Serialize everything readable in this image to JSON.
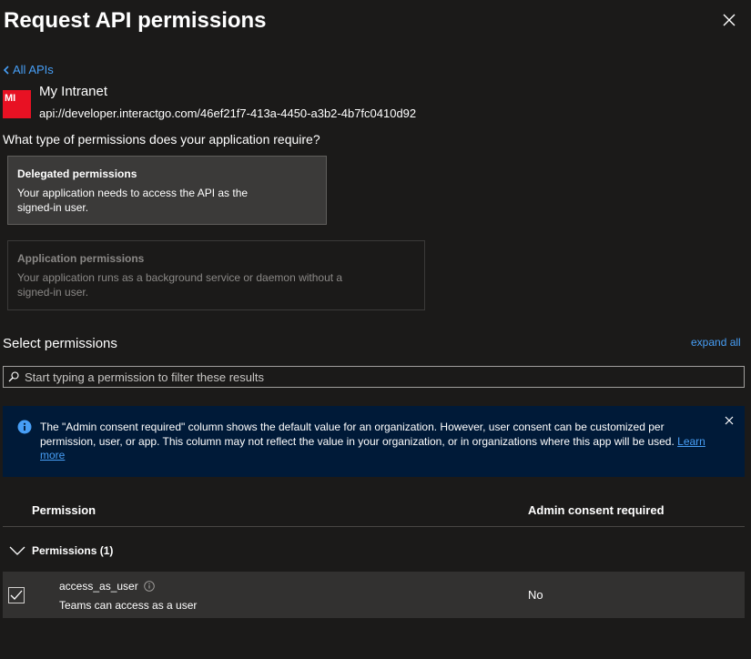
{
  "header": {
    "title": "Request API permissions"
  },
  "back_link": {
    "label": "All APIs"
  },
  "api": {
    "logo_initials": "MI",
    "name": "My Intranet",
    "uri": "api://developer.interactgo.com/46ef21f7-413a-4450-a3b2-4b7fc0410d92"
  },
  "question": "What type of permissions does your application require?",
  "permission_types": [
    {
      "title": "Delegated permissions",
      "description": "Your application needs to access the API as the signed-in user."
    },
    {
      "title": "Application permissions",
      "description": "Your application runs as a background service or daemon without a signed-in user."
    }
  ],
  "select": {
    "title": "Select permissions",
    "expand_all": "expand all",
    "search_placeholder": "Start typing a permission to filter these results"
  },
  "info_bar": {
    "text": "The \"Admin consent required\" column shows the default value for an organization. However, user consent can be customized per permission, user, or app. This column may not reflect the value in your organization, or in organizations where this app will be used.",
    "link": "Learn more"
  },
  "table": {
    "headers": [
      "Permission",
      "Admin consent required"
    ],
    "group": {
      "label": "Permissions (1)"
    },
    "rows": [
      {
        "name": "access_as_user",
        "description": "Teams can access as a user",
        "admin_consent": "No",
        "checked": true
      }
    ]
  },
  "colors": {
    "background": "#1b1a19",
    "link": "#479ef5",
    "info_bar": "#001a38",
    "logo": "#e81123",
    "selected_card": "#3b3a39"
  }
}
